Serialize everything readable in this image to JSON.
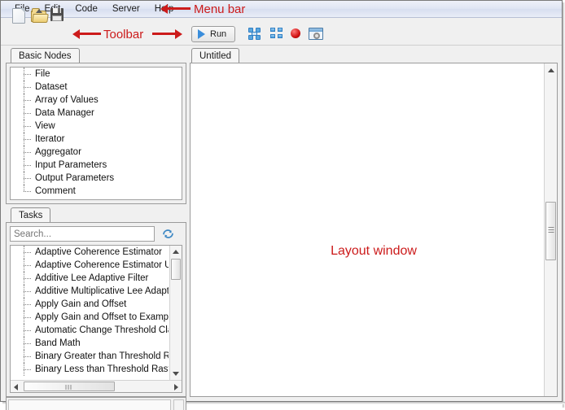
{
  "window": {
    "menu": {
      "items": [
        {
          "label": "File"
        },
        {
          "label": "Edit"
        },
        {
          "label": "Code"
        },
        {
          "label": "Server"
        },
        {
          "label": "Help"
        }
      ]
    },
    "toolbar": {
      "icons": [
        {
          "name": "new-file-icon",
          "label": "New"
        },
        {
          "name": "open-folder-icon",
          "label": "Open"
        },
        {
          "name": "save-disk-icon",
          "label": "Save"
        }
      ],
      "run_button": {
        "label": "Run",
        "icon": "play-triangle-icon",
        "accent": "#3a8ddb"
      },
      "right_icons": [
        {
          "name": "auto-layout-icon"
        },
        {
          "name": "grid-arrange-icon"
        },
        {
          "name": "record-icon",
          "color": "#d01212"
        },
        {
          "name": "window-settings-icon"
        }
      ]
    }
  },
  "annotations": {
    "color": "#cc1b1b",
    "menu_bar": "Menu bar",
    "toolbar": "Toolbar",
    "layout_window": "Layout window"
  },
  "left_dock": {
    "basic_nodes": {
      "tab_label": "Basic Nodes",
      "items": [
        "File",
        "Dataset",
        "Array of Values",
        "Data Manager",
        "View",
        "Iterator",
        "Aggregator",
        "Input Parameters",
        "Output Parameters",
        "Comment"
      ]
    },
    "tasks": {
      "tab_label": "Tasks",
      "search": {
        "value": "",
        "placeholder": "Search...",
        "refresh_icon": "refresh-icon"
      },
      "items": [
        "Adaptive Coherence Estimator",
        "Adaptive Coherence Estimator Usin",
        "Additive Lee Adaptive Filter",
        "Additive Multiplicative Lee Adaptiv",
        "Apply Gain and Offset",
        "Apply Gain and Offset to Examples",
        "Automatic Change Threshold Class",
        "Band Math",
        "Binary Greater than Threshold Ras",
        "Binary Less than Threshold Raster"
      ]
    }
  },
  "right_dock": {
    "tab_label": "Untitled",
    "canvas_label": "Layout window"
  }
}
